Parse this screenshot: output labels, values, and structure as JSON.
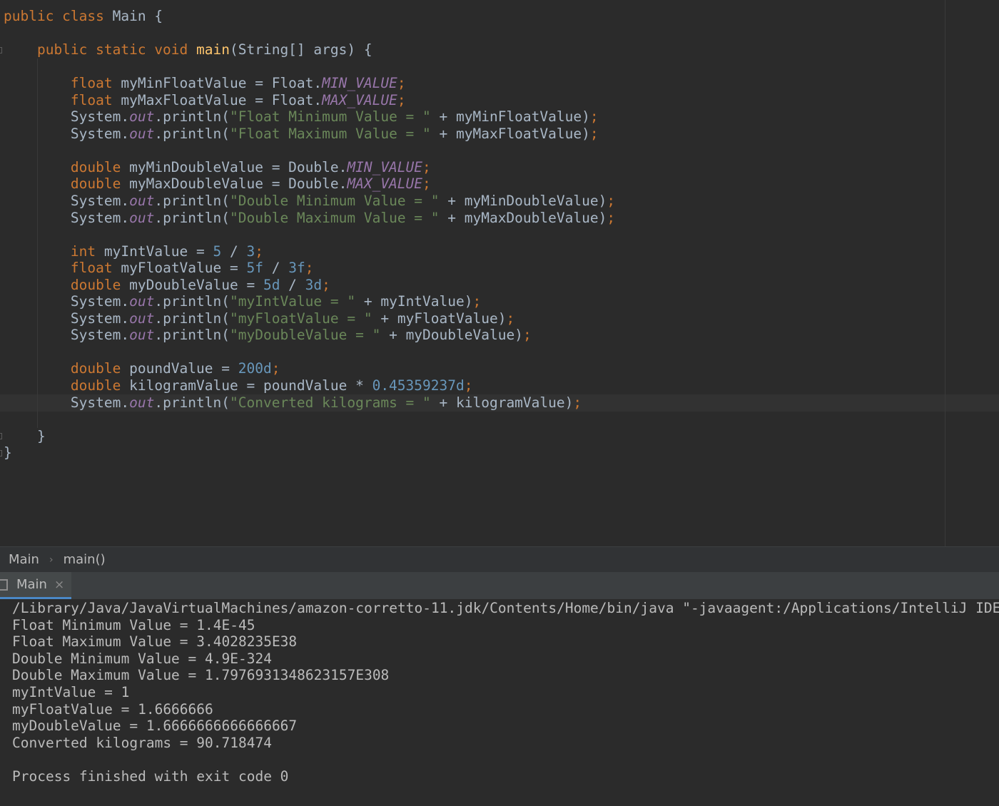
{
  "editor": {
    "lines": [
      [
        {
          "t": "public class ",
          "c": "kw"
        },
        {
          "t": "Main {",
          "c": "tx"
        }
      ],
      [],
      [
        {
          "t": "    public static void ",
          "c": "kw"
        },
        {
          "t": "main",
          "c": "fn"
        },
        {
          "t": "(String[] args) {",
          "c": "tx"
        }
      ],
      [],
      [
        {
          "t": "        float ",
          "c": "kw"
        },
        {
          "t": "myMinFloatValue = Float.",
          "c": "tx"
        },
        {
          "t": "MIN_VALUE",
          "c": "fld"
        },
        {
          "t": ";",
          "c": "kw"
        }
      ],
      [
        {
          "t": "        float ",
          "c": "kw"
        },
        {
          "t": "myMaxFloatValue = Float.",
          "c": "tx"
        },
        {
          "t": "MAX_VALUE",
          "c": "fld"
        },
        {
          "t": ";",
          "c": "kw"
        }
      ],
      [
        {
          "t": "        System.",
          "c": "tx"
        },
        {
          "t": "out",
          "c": "fld"
        },
        {
          "t": ".println(",
          "c": "tx"
        },
        {
          "t": "\"Float Minimum Value = \"",
          "c": "st"
        },
        {
          "t": " + myMinFloatValue)",
          "c": "tx"
        },
        {
          "t": ";",
          "c": "kw"
        }
      ],
      [
        {
          "t": "        System.",
          "c": "tx"
        },
        {
          "t": "out",
          "c": "fld"
        },
        {
          "t": ".println(",
          "c": "tx"
        },
        {
          "t": "\"Float Maximum Value = \"",
          "c": "st"
        },
        {
          "t": " + myMaxFloatValue)",
          "c": "tx"
        },
        {
          "t": ";",
          "c": "kw"
        }
      ],
      [],
      [
        {
          "t": "        double ",
          "c": "kw"
        },
        {
          "t": "myMinDoubleValue = Double.",
          "c": "tx"
        },
        {
          "t": "MIN_VALUE",
          "c": "fld"
        },
        {
          "t": ";",
          "c": "kw"
        }
      ],
      [
        {
          "t": "        double ",
          "c": "kw"
        },
        {
          "t": "myMaxDoubleValue = Double.",
          "c": "tx"
        },
        {
          "t": "MAX_VALUE",
          "c": "fld"
        },
        {
          "t": ";",
          "c": "kw"
        }
      ],
      [
        {
          "t": "        System.",
          "c": "tx"
        },
        {
          "t": "out",
          "c": "fld"
        },
        {
          "t": ".println(",
          "c": "tx"
        },
        {
          "t": "\"Double Minimum Value = \"",
          "c": "st"
        },
        {
          "t": " + myMinDoubleValue)",
          "c": "tx"
        },
        {
          "t": ";",
          "c": "kw"
        }
      ],
      [
        {
          "t": "        System.",
          "c": "tx"
        },
        {
          "t": "out",
          "c": "fld"
        },
        {
          "t": ".println(",
          "c": "tx"
        },
        {
          "t": "\"Double Maximum Value = \"",
          "c": "st"
        },
        {
          "t": " + myMaxDoubleValue)",
          "c": "tx"
        },
        {
          "t": ";",
          "c": "kw"
        }
      ],
      [],
      [
        {
          "t": "        int ",
          "c": "kw"
        },
        {
          "t": "myIntValue = ",
          "c": "tx"
        },
        {
          "t": "5",
          "c": "num"
        },
        {
          "t": " / ",
          "c": "tx"
        },
        {
          "t": "3",
          "c": "num"
        },
        {
          "t": ";",
          "c": "kw"
        }
      ],
      [
        {
          "t": "        float ",
          "c": "kw"
        },
        {
          "t": "myFloatValue = ",
          "c": "tx"
        },
        {
          "t": "5f",
          "c": "num"
        },
        {
          "t": " / ",
          "c": "tx"
        },
        {
          "t": "3f",
          "c": "num"
        },
        {
          "t": ";",
          "c": "kw"
        }
      ],
      [
        {
          "t": "        double ",
          "c": "kw"
        },
        {
          "t": "myDoubleValue = ",
          "c": "tx"
        },
        {
          "t": "5d",
          "c": "num"
        },
        {
          "t": " / ",
          "c": "tx"
        },
        {
          "t": "3d",
          "c": "num"
        },
        {
          "t": ";",
          "c": "kw"
        }
      ],
      [
        {
          "t": "        System.",
          "c": "tx"
        },
        {
          "t": "out",
          "c": "fld"
        },
        {
          "t": ".println(",
          "c": "tx"
        },
        {
          "t": "\"myIntValue = \"",
          "c": "st"
        },
        {
          "t": " + myIntValue)",
          "c": "tx"
        },
        {
          "t": ";",
          "c": "kw"
        }
      ],
      [
        {
          "t": "        System.",
          "c": "tx"
        },
        {
          "t": "out",
          "c": "fld"
        },
        {
          "t": ".println(",
          "c": "tx"
        },
        {
          "t": "\"myFloatValue = \"",
          "c": "st"
        },
        {
          "t": " + myFloatValue)",
          "c": "tx"
        },
        {
          "t": ";",
          "c": "kw"
        }
      ],
      [
        {
          "t": "        System.",
          "c": "tx"
        },
        {
          "t": "out",
          "c": "fld"
        },
        {
          "t": ".println(",
          "c": "tx"
        },
        {
          "t": "\"myDoubleValue = \"",
          "c": "st"
        },
        {
          "t": " + myDoubleValue)",
          "c": "tx"
        },
        {
          "t": ";",
          "c": "kw"
        }
      ],
      [],
      [
        {
          "t": "        double ",
          "c": "kw"
        },
        {
          "t": "poundValue = ",
          "c": "tx"
        },
        {
          "t": "200d",
          "c": "num"
        },
        {
          "t": ";",
          "c": "kw"
        }
      ],
      [
        {
          "t": "        double ",
          "c": "kw"
        },
        {
          "t": "kilogramValue = poundValue * ",
          "c": "tx"
        },
        {
          "t": "0.45359237d",
          "c": "num"
        },
        {
          "t": ";",
          "c": "kw"
        }
      ],
      [
        {
          "t": "        System.",
          "c": "tx"
        },
        {
          "t": "out",
          "c": "fld"
        },
        {
          "t": ".println(",
          "c": "tx"
        },
        {
          "t": "\"Converted kilograms = \"",
          "c": "st"
        },
        {
          "t": " + kilogramValue)",
          "c": "tx"
        },
        {
          "t": ";",
          "c": "kw"
        }
      ],
      [],
      [
        {
          "t": "    }",
          "c": "tx"
        }
      ],
      [
        {
          "t": "}",
          "c": "tx"
        }
      ]
    ]
  },
  "breadcrumb": {
    "class_name": "Main",
    "separator": "›",
    "method_name": "main()"
  },
  "run_panel": {
    "tab_label": "Main",
    "close_glyph": "×"
  },
  "console": {
    "lines": [
      "/Library/Java/JavaVirtualMachines/amazon-corretto-11.jdk/Contents/Home/bin/java \"-javaagent:/Applications/IntelliJ IDEA CE.app",
      "Float Minimum Value = 1.4E-45",
      "Float Maximum Value = 3.4028235E38",
      "Double Minimum Value = 4.9E-324",
      "Double Maximum Value = 1.7976931348623157E308",
      "myIntValue = 1",
      "myFloatValue = 1.6666666",
      "myDoubleValue = 1.6666666666666667",
      "Converted kilograms = 90.718474",
      "",
      "Process finished with exit code 0"
    ]
  },
  "colors": {
    "background": "#2b2b2b",
    "keyword": "#cc7832",
    "function": "#ffc66d",
    "string": "#6a8759",
    "field": "#9876aa",
    "number": "#6897bb",
    "text": "#a9b7c6"
  }
}
